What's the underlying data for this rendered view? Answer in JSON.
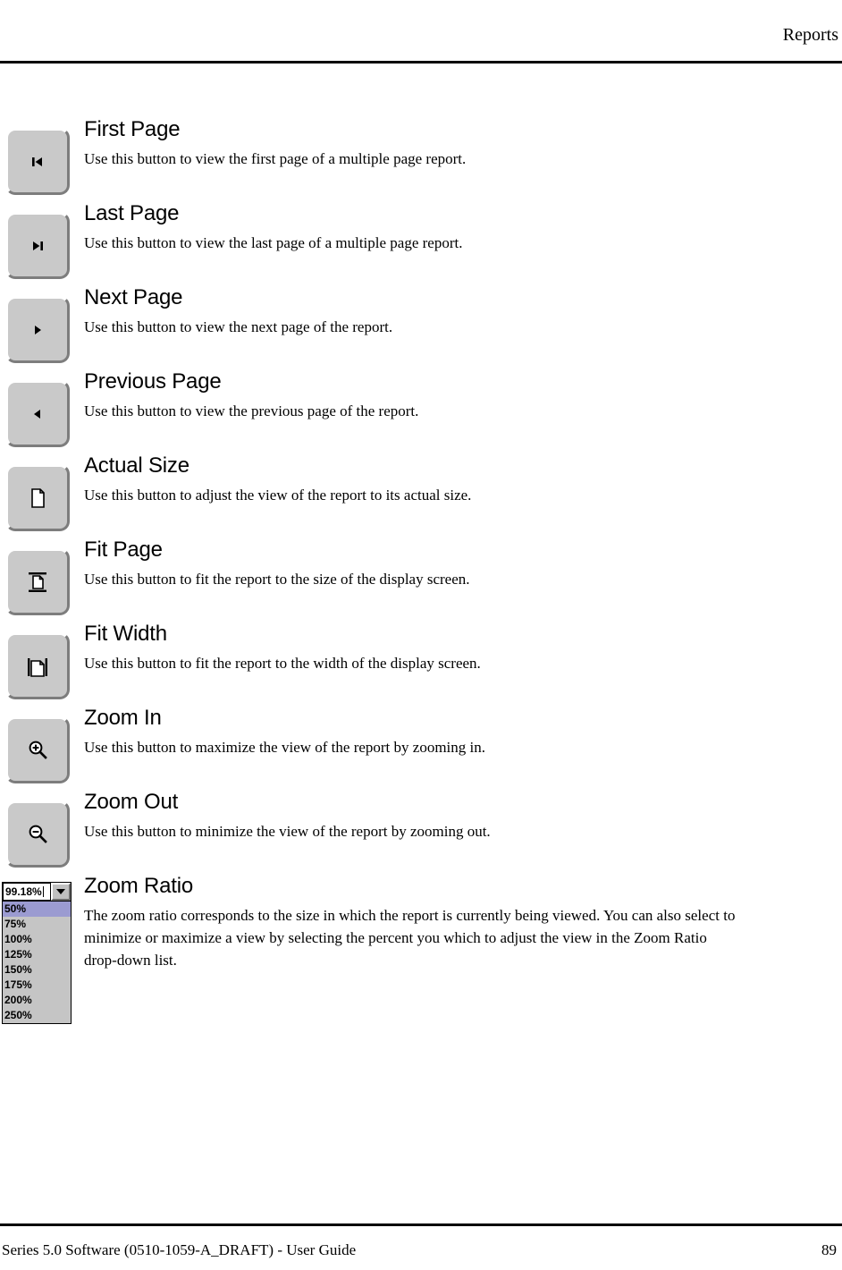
{
  "header": {
    "title": "Reports"
  },
  "footer": {
    "document_label": "Series 5.0 Software (0510-1059-A_DRAFT) - User Guide",
    "page_number": "89"
  },
  "entries": [
    {
      "icon": "first-page-icon",
      "title": "First Page",
      "description": "Use this button to view the first page of a multiple page report."
    },
    {
      "icon": "last-page-icon",
      "title": "Last Page",
      "description": "Use this button to view the last page of a multiple page report."
    },
    {
      "icon": "next-page-icon",
      "title": "Next Page",
      "description": "Use this button to view the next page of the report."
    },
    {
      "icon": "previous-page-icon",
      "title": "Previous Page",
      "description": "Use this button to view the previous page of the report."
    },
    {
      "icon": "actual-size-icon",
      "title": "Actual Size",
      "description": "Use this button to adjust the view of the report to its actual size."
    },
    {
      "icon": "fit-page-icon",
      "title": "Fit Page",
      "description": "Use this button to fit the report to the size of the display screen."
    },
    {
      "icon": "fit-width-icon",
      "title": "Fit Width",
      "description": "Use this button to fit the report to the width of the display screen."
    },
    {
      "icon": "zoom-in-icon",
      "title": "Zoom In",
      "description": "Use this button to maximize the view of the report by zooming in."
    },
    {
      "icon": "zoom-out-icon",
      "title": "Zoom Out",
      "description": "Use this button to minimize the view of the report by zooming out."
    }
  ],
  "zoom_ratio": {
    "title": "Zoom Ratio",
    "description": "The zoom ratio corresponds to the size in which the report is currently being viewed. You can also select to minimize or maximize a view by selecting the percent you which to adjust the view in the Zoom Ratio drop-down list.",
    "combo": {
      "value": "99.18%",
      "options": [
        "50%",
        "75%",
        "100%",
        "125%",
        "150%",
        "175%",
        "200%",
        "250%"
      ],
      "selected_option": "50%",
      "highlight_color": "#9b9bd1"
    }
  },
  "colors": {
    "button_face": "#c9c9c9",
    "button_highlight": "#ffffff",
    "button_shadow": "#7d7d7d",
    "text": "#000000",
    "page_background": "#ffffff"
  }
}
